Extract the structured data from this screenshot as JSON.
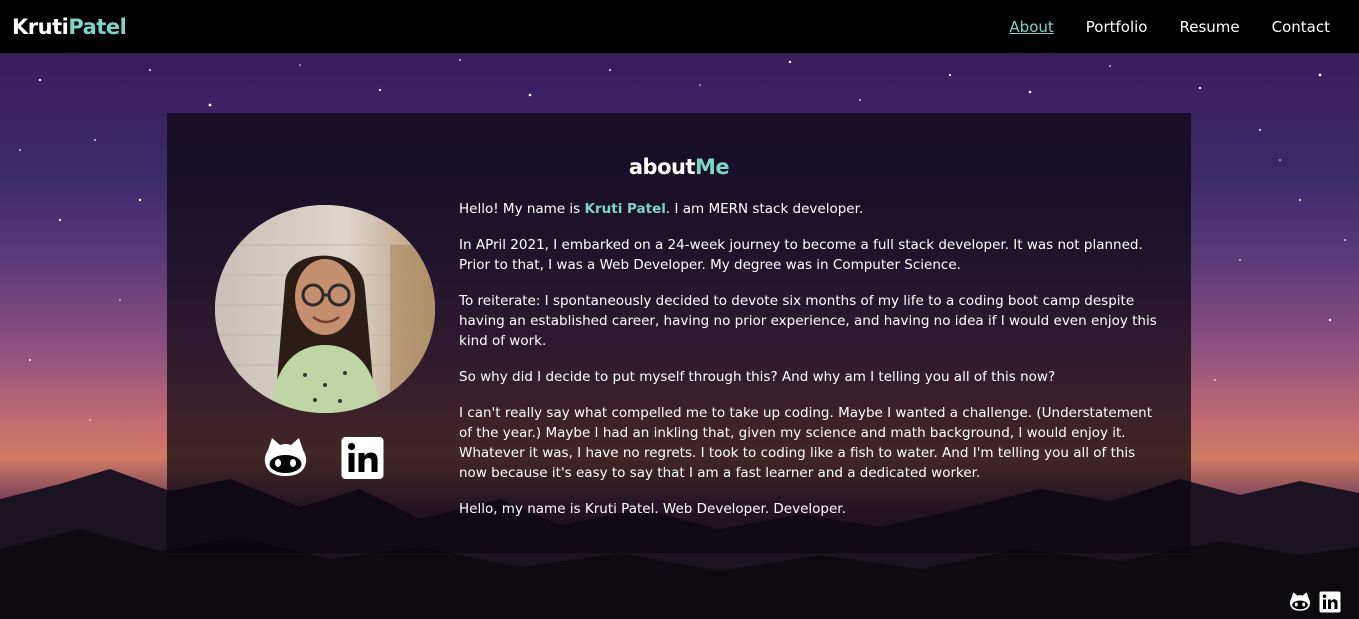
{
  "brand": {
    "first": "Kruti",
    "last": "Patel"
  },
  "nav": {
    "items": [
      {
        "label": "About",
        "active": true
      },
      {
        "label": "Portfolio",
        "active": false
      },
      {
        "label": "Resume",
        "active": false
      },
      {
        "label": "Contact",
        "active": false
      }
    ]
  },
  "about": {
    "title_a": "about",
    "title_b": "Me",
    "intro_prefix": "Hello! My name is ",
    "intro_name": "Kruti Patel",
    "intro_suffix": ". I am MERN stack developer.",
    "p2": "In APril 2021, I embarked on a 24-week journey to become a full stack developer. It was not planned. Prior to that, I was a Web Developer. My degree was in Computer Science.",
    "p3": "To reiterate: I spontaneously decided to devote six months of my life to a coding boot camp despite having an established career, having no prior experience, and having no idea if I would even enjoy this kind of work.",
    "p4": "So why did I decide to put myself through this? And why am I telling you all of this now?",
    "p5": "I can't really say what compelled me to take up coding. Maybe I wanted a challenge. (Understatement of the year.) Maybe I had an inkling that, given my science and math background, I would enjoy it. Whatever it was, I have no regrets. I took to coding like a fish to water. And I'm telling you all of this now because it's easy to say that I am a fast learner and a dedicated worker.",
    "p6": "Hello, my name is Kruti Patel. Web Developer. Developer."
  },
  "social": {
    "github_icon": "github-icon",
    "linkedin_icon": "linkedin-icon"
  },
  "colors": {
    "accent": "#7fd3c7",
    "header_bg": "#000000"
  }
}
